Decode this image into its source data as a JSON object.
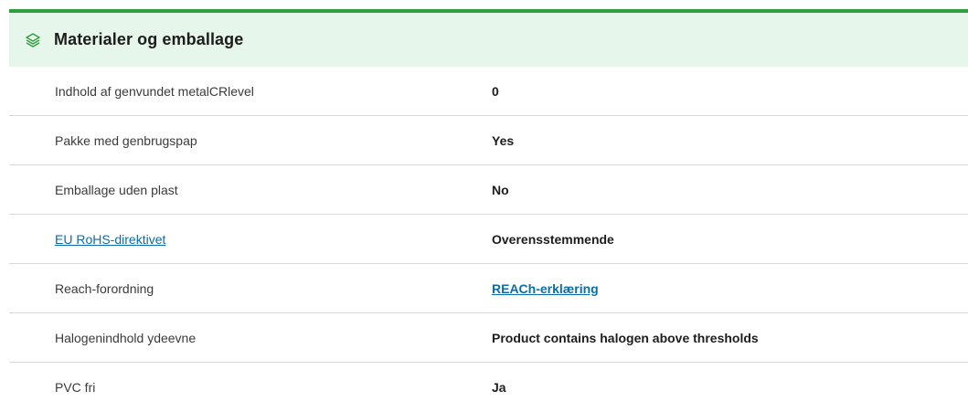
{
  "section": {
    "title": "Materialer og emballage",
    "icon": "layers-icon",
    "accent_color": "#2f9e3f",
    "header_bg": "#e7f6ea"
  },
  "rows": [
    {
      "label": "Indhold af genvundet metalCRlevel",
      "value": "0"
    },
    {
      "label": "Pakke med genbrugspap",
      "value": "Yes"
    },
    {
      "label": "Emballage uden plast",
      "value": "No"
    },
    {
      "label": "EU RoHS-direktivet",
      "value": "Overensstemmende",
      "label_is_link": true
    },
    {
      "label": "Reach-forordning",
      "value": "REACh-erklæring",
      "value_is_link": true
    },
    {
      "label": "Halogenindhold ydeevne",
      "value": "Product contains halogen above thresholds"
    },
    {
      "label": "PVC fri",
      "value": "Ja"
    }
  ]
}
